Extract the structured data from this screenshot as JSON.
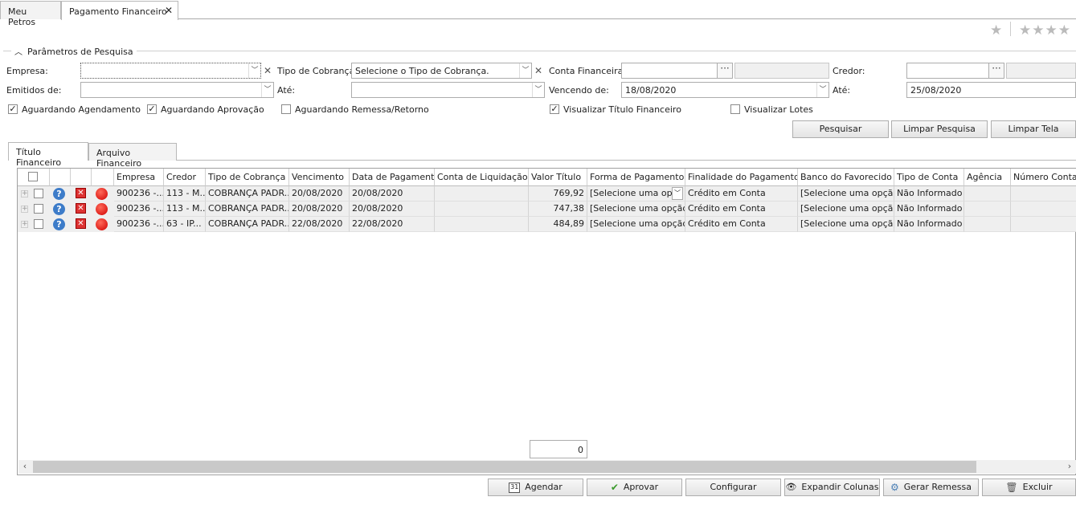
{
  "tabs": [
    {
      "label": "Meu Petros"
    },
    {
      "label": "Pagamento Financeiro"
    }
  ],
  "close_glyph": "✕",
  "star_single": "★",
  "stars_rating": "★★★★",
  "params": {
    "title": "Parâmetros de Pesquisa",
    "empresa_label": "Empresa:",
    "empresa_value": "",
    "tipo_cobranca_label": "Tipo de Cobrança:",
    "tipo_cobranca_value": "Selecione o Tipo de Cobrança.",
    "conta_financeira_label": "Conta Financeira:",
    "conta_financeira_value": "",
    "credor_label": "Credor:",
    "credor_value": "",
    "emitidos_label": "Emitidos de:",
    "emitidos_value": "",
    "ate1_label": "Até:",
    "ate1_value": "",
    "vencendo_label": "Vencendo de:",
    "vencendo_value": "18/08/2020",
    "ate2_label": "Até:",
    "ate2_value": "25/08/2020",
    "checkboxes": [
      {
        "label": "Aguardando Agendamento",
        "checked": true
      },
      {
        "label": "Aguardando Aprovação",
        "checked": true
      },
      {
        "label": "Aguardando Remessa/Retorno",
        "checked": false
      },
      {
        "label": "Visualizar Título Financeiro",
        "checked": true
      },
      {
        "label": "Visualizar Lotes",
        "checked": false
      }
    ],
    "btn_pesquisar": "Pesquisar",
    "btn_limpar_pesquisa": "Limpar Pesquisa",
    "btn_limpar_tela": "Limpar Tela"
  },
  "panel_tabs": [
    {
      "label": "Título Financeiro"
    },
    {
      "label": "Arquivo Financeiro"
    }
  ],
  "grid": {
    "columns": [
      "Empresa",
      "Credor",
      "Tipo de Cobrança",
      "Vencimento",
      "Data de Pagamento",
      "Conta de Liquidação",
      "Valor Título",
      "Forma de Pagamento",
      "Finalidade do Pagamento",
      "Banco do Favorecido",
      "Tipo de Conta",
      "Agência",
      "Número Conta"
    ],
    "rows": [
      [
        "900236 -...",
        "113 - M...",
        "COBRANÇA PADR...",
        "20/08/2020",
        "20/08/2020",
        "",
        "769,92",
        "[Selecione uma op...",
        "Crédito em Conta",
        "[Selecione uma opção]",
        "Não Informado",
        "",
        ""
      ],
      [
        "900236 -...",
        "113 - M...",
        "COBRANÇA PADR...",
        "20/08/2020",
        "20/08/2020",
        "",
        "747,38",
        "[Selecione uma opção]",
        "Crédito em Conta",
        "[Selecione uma opção]",
        "Não Informado",
        "",
        ""
      ],
      [
        "900236 -...",
        "63 - IP...",
        "COBRANÇA PADR...",
        "22/08/2020",
        "22/08/2020",
        "",
        "484,89",
        "[Selecione uma opção]",
        "Crédito em Conta",
        "[Selecione uma opção]",
        "Não Informado",
        "",
        ""
      ]
    ],
    "total": "0"
  },
  "actions": {
    "agendar": "Agendar",
    "calendar_day": "31",
    "aprovar": "Aprovar",
    "configurar": "Configurar",
    "expandir": "Expandir Colunas",
    "gerar": "Gerar Remessa",
    "excluir": "Excluir"
  }
}
